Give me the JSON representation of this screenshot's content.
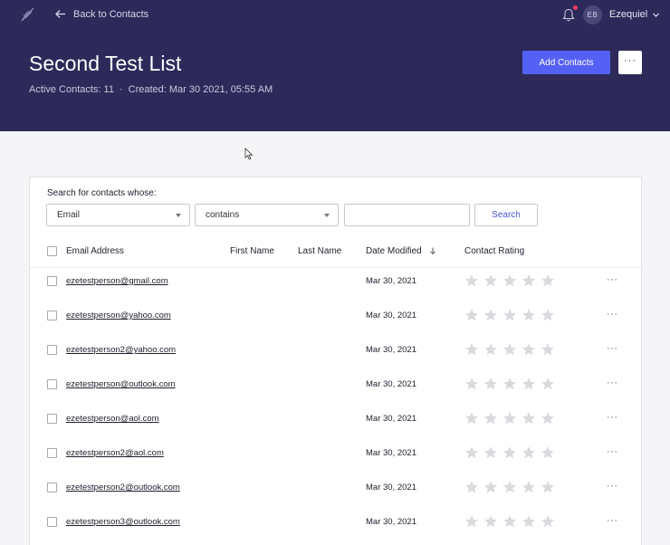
{
  "header": {
    "back_label": "Back to Contacts",
    "user_initials": "EB",
    "user_name": "Ezequiel",
    "list_title": "Second Test List",
    "active_contacts": "Active Contacts: 11",
    "separator": "·",
    "created": "Created: Mar 30 2021, 05:55 AM",
    "add_contacts_label": "Add Contacts",
    "more_label": "···",
    "brand_color": "#2d2a5a",
    "accent_color": "#5561f4",
    "notification_dot_color": "#ef3b66"
  },
  "search": {
    "label": "Search for contacts whose:",
    "field_value": "Email",
    "operator_value": "contains",
    "input_value": "",
    "button_label": "Search"
  },
  "table": {
    "columns": {
      "email": "Email Address",
      "first_name": "First Name",
      "last_name": "Last Name",
      "date_modified": "Date Modified",
      "rating": "Contact Rating"
    },
    "rows": [
      {
        "email": "ezetestperson@gmail.com",
        "first_name": "",
        "last_name": "",
        "date": "Mar 30, 2021",
        "rating": 0,
        "actions": "···"
      },
      {
        "email": "ezetestperson@yahoo.com",
        "first_name": "",
        "last_name": "",
        "date": "Mar 30, 2021",
        "rating": 0,
        "actions": "···"
      },
      {
        "email": "ezetestperson2@yahoo.com",
        "first_name": "",
        "last_name": "",
        "date": "Mar 30, 2021",
        "rating": 0,
        "actions": "···"
      },
      {
        "email": "ezetestperson@outlook.com",
        "first_name": "",
        "last_name": "",
        "date": "Mar 30, 2021",
        "rating": 0,
        "actions": "···"
      },
      {
        "email": "ezetestperson@aol.com",
        "first_name": "",
        "last_name": "",
        "date": "Mar 30, 2021",
        "rating": 0,
        "actions": "···"
      },
      {
        "email": "ezetestperson2@aol.com",
        "first_name": "",
        "last_name": "",
        "date": "Mar 30, 2021",
        "rating": 0,
        "actions": "···"
      },
      {
        "email": "ezetestperson2@outlook.com",
        "first_name": "",
        "last_name": "",
        "date": "Mar 30, 2021",
        "rating": 0,
        "actions": "···"
      },
      {
        "email": "ezetestperson3@outlook.com",
        "first_name": "",
        "last_name": "",
        "date": "Mar 30, 2021",
        "rating": 0,
        "actions": "···"
      }
    ],
    "star_color": "#d9d9de"
  }
}
